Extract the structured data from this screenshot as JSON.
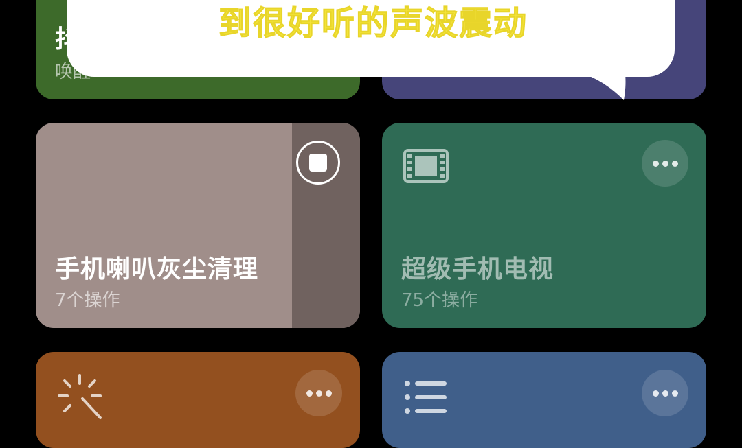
{
  "top_left_card": {
    "title": "抖",
    "subtitle": "唤醒"
  },
  "card_speaker": {
    "title": "手机喇叭灰尘清理",
    "subtitle": "7个操作",
    "color": "#a08e8a",
    "progress_color": "#70625f"
  },
  "card_tv": {
    "title": "超级手机电视",
    "subtitle": "75个操作",
    "color": "#2f6b55"
  },
  "card_orange": {
    "color": "#93501f"
  },
  "card_blue": {
    "color": "#405f8a"
  },
  "caption": {
    "text": "到很好听的声波震动"
  },
  "icons": {
    "stop": "stop-icon",
    "film": "film-icon",
    "magic": "magic-wand-icon",
    "list": "list-icon",
    "more": "more-icon"
  }
}
